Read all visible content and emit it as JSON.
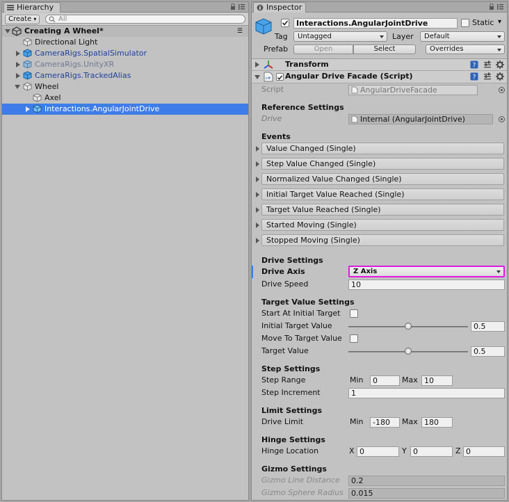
{
  "hierarchy": {
    "tab_label": "Hierarchy",
    "create_label": "Create",
    "search_placeholder": "All",
    "scene_name": "Creating A Wheel*",
    "items": [
      {
        "label": "Directional Light",
        "color": "#111111"
      },
      {
        "label": "CameraRigs.SpatialSimulator",
        "color": "#1f3f9c"
      },
      {
        "label": "CameraRigs.UnityXR",
        "color": "#6d7a90"
      },
      {
        "label": "CameraRigs.TrackedAlias",
        "color": "#1f3f9c"
      },
      {
        "label": "Wheel",
        "color": "#111111"
      },
      {
        "label": "Axel",
        "color": "#111111"
      },
      {
        "label": "Interactions.AngularJointDrive",
        "color": "#ffffff",
        "selected": true
      }
    ]
  },
  "inspector": {
    "tab_label": "Inspector",
    "object_name": "Interactions.AngularJointDrive",
    "static_label": "Static",
    "tag_label": "Tag",
    "tag_value": "Untagged",
    "layer_label": "Layer",
    "layer_value": "Default",
    "prefab_label": "Prefab",
    "prefab_open": "Open",
    "prefab_select": "Select",
    "prefab_overrides": "Overrides",
    "transform_label": "Transform",
    "component_title": "Angular Drive Facade (Script)",
    "script_label": "Script",
    "script_value": "AngularDriveFacade",
    "reference_settings": "Reference Settings",
    "drive_label": "Drive",
    "drive_value": "Internal (AngularJointDrive)",
    "events_heading": "Events",
    "events": [
      "Value Changed (Single)",
      "Step Value Changed (Single)",
      "Normalized Value Changed (Single)",
      "Initial Target Value Reached (Single)",
      "Target Value Reached (Single)",
      "Started Moving (Single)",
      "Stopped Moving (Single)"
    ],
    "drive_settings": "Drive Settings",
    "drive_axis_label": "Drive Axis",
    "drive_axis_value": "Z Axis",
    "drive_speed_label": "Drive Speed",
    "drive_speed_value": "10",
    "target_value_settings": "Target Value Settings",
    "start_at_initial_label": "Start At Initial Target",
    "initial_target_label": "Initial Target Value",
    "initial_target_value": "0.5",
    "initial_target_fraction": 0.5,
    "move_to_target_label": "Move To Target Value",
    "target_value_label": "Target Value",
    "target_value_value": "0.5",
    "target_value_fraction": 0.5,
    "step_settings": "Step Settings",
    "step_range_label": "Step Range",
    "min_label": "Min",
    "max_label": "Max",
    "step_min": "0",
    "step_max": "10",
    "step_increment_label": "Step Increment",
    "step_increment_value": "1",
    "limit_settings": "Limit Settings",
    "drive_limit_label": "Drive Limit",
    "limit_min": "-180",
    "limit_max": "180",
    "hinge_settings": "Hinge Settings",
    "hinge_location_label": "Hinge Location",
    "x_label": "X",
    "y_label": "Y",
    "z_label": "Z",
    "hinge_x": "0",
    "hinge_y": "0",
    "hinge_z": "0",
    "gizmo_settings": "Gizmo Settings",
    "gizmo_line_label": "Gizmo Line Distance",
    "gizmo_line_value": "0.2",
    "gizmo_sphere_label": "Gizmo Sphere Radius",
    "gizmo_sphere_value": "0.015"
  },
  "colors": {
    "selection": "#3e7de7",
    "highlight_outline": "#e01be0",
    "prefab_blue": "#1f3f9c"
  }
}
